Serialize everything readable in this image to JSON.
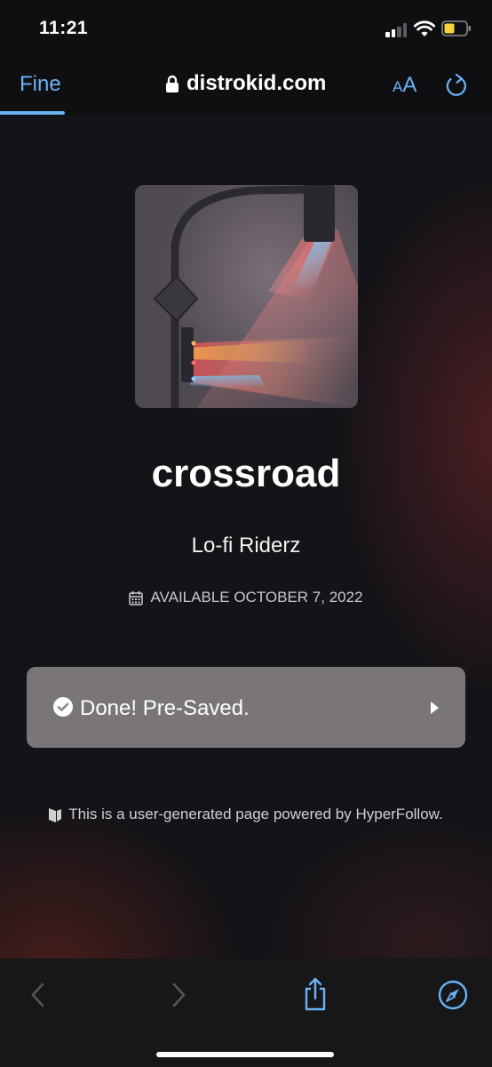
{
  "status_bar": {
    "time": "11:21"
  },
  "browser": {
    "back_label": "Fine",
    "url": "distrokid.com",
    "text_size_label_small": "A",
    "text_size_label_large": "A"
  },
  "release": {
    "title": "crossroad",
    "artist": "Lo-fi Riderz",
    "availability": "AVAILABLE OCTOBER 7, 2022",
    "presave_status": "Done! Pre-Saved.",
    "footer_note": "This is a user-generated page powered by HyperFollow."
  },
  "icons": {
    "status": [
      "signal-icon",
      "wifi-icon",
      "battery-icon"
    ],
    "browser": [
      "lock-icon",
      "text-size-icon",
      "reload-icon"
    ],
    "page": [
      "calendar-icon",
      "check-circle-icon",
      "chevron-right-icon",
      "hyperfollow-logo-icon"
    ],
    "toolbar": [
      "back-arrow-icon",
      "forward-arrow-icon",
      "share-icon",
      "compass-icon"
    ]
  },
  "colors": {
    "accent": "#6cb3f5",
    "background": "#141317",
    "button_background": "#969194",
    "battery_fill": "#f5d33b"
  }
}
